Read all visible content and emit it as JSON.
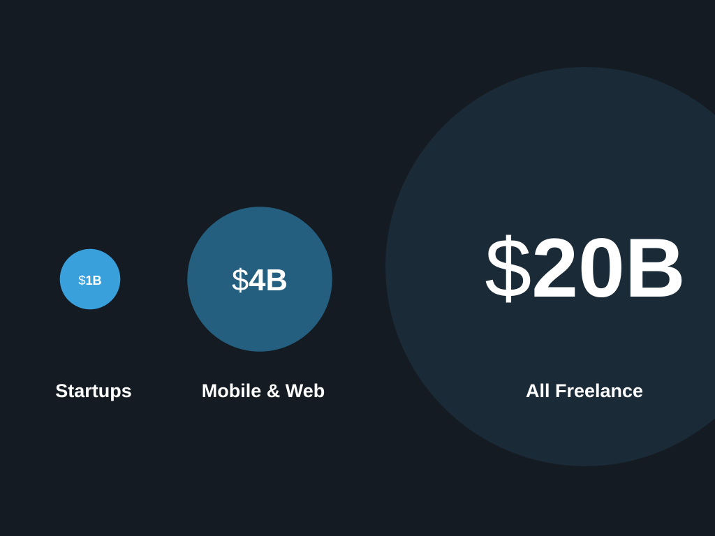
{
  "chart_data": {
    "type": "bubble",
    "title": "",
    "categories": [
      "Startups",
      "Mobile & Web",
      "All Freelance"
    ],
    "values": [
      1,
      4,
      20
    ],
    "value_labels": [
      "$1B",
      "$4B",
      "$20B"
    ],
    "currency_symbol": "$",
    "amounts": [
      "1B",
      "4B",
      "20B"
    ],
    "colors": [
      "#3aa0dc",
      "#255f80",
      "#1a2a37"
    ]
  }
}
